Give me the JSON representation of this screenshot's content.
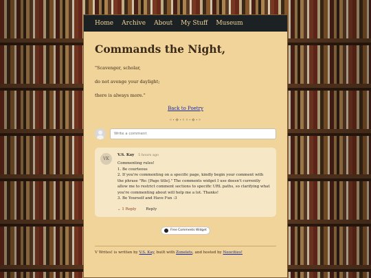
{
  "nav": {
    "items": [
      "Home",
      "Archive",
      "About",
      "My Stuff",
      "Museum"
    ]
  },
  "page": {
    "title": "Commands the Night,",
    "verse": [
      "\"Scavenger, scholar,",
      "do not avenge your daylight;",
      "there is always more.\""
    ],
    "back_link": "Back to Poetry",
    "divider": "◦·✧·◦◦·✧·◦"
  },
  "comments": {
    "input_placeholder": "Write a comment",
    "items": [
      {
        "avatar": "VK",
        "author": "V.S. Kay",
        "time": "5 hours ago",
        "lines": [
          "Commenting rules!",
          "1. Be courteous",
          "2. If you're commenting on a specific page, kindly begin your comment with the phrase \"Re: [Page title].\" The comments widget I use doesn't currently allow me to restrict comment sections to specific URL paths, so clarifying what you're commenting about will help me a lot. Thanks!",
          "3. Be Yourself and Have Fun :3"
        ],
        "replies_label": "1 Reply",
        "reply_label": "Reply"
      }
    ],
    "widget_label": "Free Comments Widget"
  },
  "footer": {
    "prefix": "V Writes! is written by ",
    "author_link": "V.S. Kay",
    "middle": ", built with ",
    "built_link": "Zonelets",
    "middle2": ", and hosted by ",
    "host_link": "Neocities!"
  }
}
